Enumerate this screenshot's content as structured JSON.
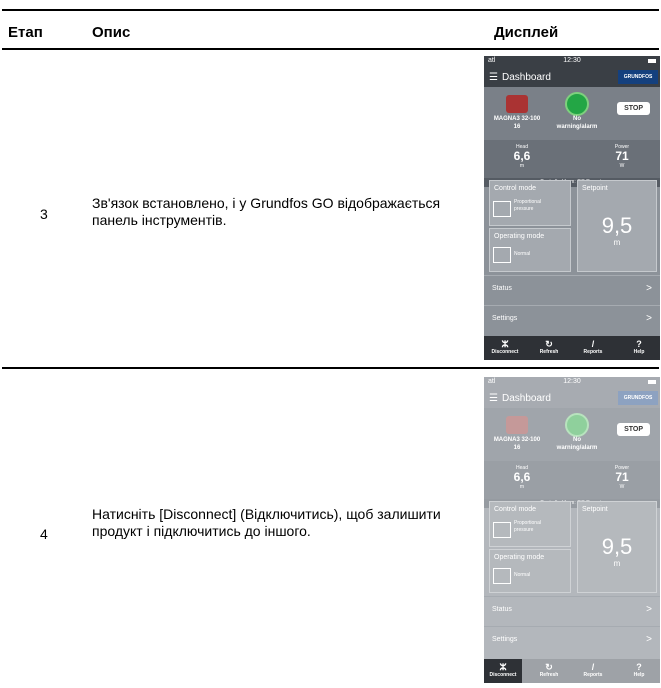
{
  "table": {
    "headers": {
      "step": "Етап",
      "desc": "Опис",
      "display": "Дисплей"
    },
    "rows": [
      {
        "step": "3",
        "desc": "Зв'язок встановлено, і у Grundfos GO відображається панель інструментів."
      },
      {
        "step": "4",
        "desc": "Натисніть [Disconnect] (Відключитись), щоб залишити продукт і підключитись до іншого."
      }
    ]
  },
  "phone": {
    "time": "12:30",
    "signal": "atl",
    "title": "Dashboard",
    "logo": "GRUNDFOS",
    "pump_name_line1": "MAGNA3 32-100",
    "pump_name_line2": "16",
    "alarm_line1": "No",
    "alarm_line2": "warning/alarm",
    "stop": "STOP",
    "head_label": "Head",
    "head_value": "6,6",
    "head_unit": "m",
    "power_label": "Power",
    "power_value": "71",
    "power_unit": "W",
    "controlled_from": "Controlled from: GO Remote",
    "control_mode_label": "Control mode",
    "control_mode_value_1": "Proportional",
    "control_mode_value_2": "pressure",
    "setpoint_label": "Setpoint",
    "setpoint_value": "9,5",
    "setpoint_unit": "m",
    "operating_mode_label": "Operating mode",
    "operating_mode_value": "Normal",
    "status": "Status",
    "settings": "Settings",
    "chevron": ">",
    "bottom": {
      "disconnect": "Disconnect",
      "refresh": "Refresh",
      "reports": "Reports",
      "help": "Help"
    },
    "icons": {
      "hamburger": "menu-icon",
      "disconnect": "disconnect-icon",
      "refresh": "refresh-icon",
      "reports": "pencil-icon",
      "help": "help-icon"
    }
  }
}
